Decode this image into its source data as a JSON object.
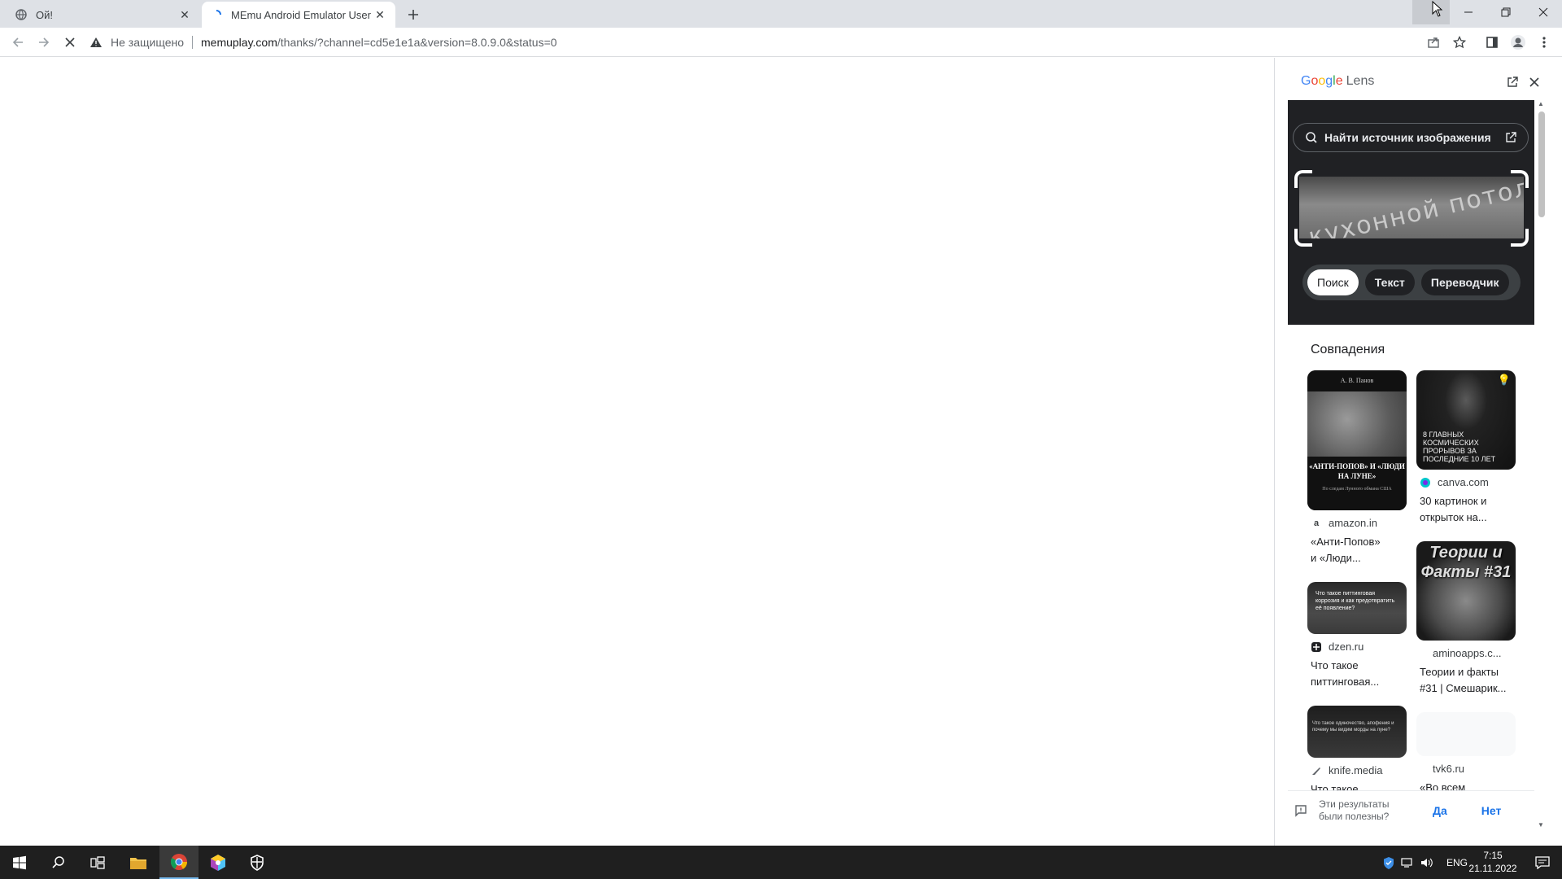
{
  "tabs": [
    {
      "title": "Ой!",
      "active": false
    },
    {
      "title": "MEmu Android Emulator User Gu",
      "active": true
    }
  ],
  "toolbar": {
    "security_label": "Не защищено",
    "url_host": "memuplay.com",
    "url_path": "/thanks/?channel=cd5e1e1a&version=8.0.9.0&status=0"
  },
  "lens": {
    "brand": "Google",
    "brand_suffix": "Lens",
    "find_source_label": "Найти источник изображения",
    "crop_text": "кухонной потолок",
    "modes": [
      "Поиск",
      "Текст",
      "Переводчик"
    ],
    "selected_mode": "Поиск",
    "matches_title": "Совпадения",
    "results": [
      {
        "source": "amazon.in",
        "caption_line1": "«Анти-Попов»",
        "caption_line2": "и «Люди...",
        "thumb_top": "А. В. Панов",
        "thumb_title": "«АНТИ-ПОПОВ» И «ЛЮДИ НА ЛУНЕ»",
        "thumb_sub": "По следам Лунного обмана США"
      },
      {
        "source": "canva.com",
        "caption_line1": "30 картинок и",
        "caption_line2": "открыток на...",
        "thumb_text": "8 ГЛАВНЫХ КОСМИЧЕСКИХ ПРОРЫВОВ ЗА ПОСЛЕДНИЕ 10 ЛЕТ"
      },
      {
        "source": "dzen.ru",
        "caption_line1": "Что такое",
        "caption_line2": "питтинговая...",
        "thumb_text": "Что такое питтинговая коррозия и как предотвратить её появление?"
      },
      {
        "source": "aminoapps.c...",
        "caption_line1": "Теории и факты",
        "caption_line2": "#31 | Смешарик...",
        "thumb_text": "Теории и Факты #31"
      },
      {
        "source": "knife.media",
        "caption_line1": "Что такое",
        "caption_line2": "",
        "thumb_text": "Что такое одиночество, апофения и почему мы видим морды на луне?"
      },
      {
        "source": "tvk6.ru",
        "caption_line1": "«Во всем",
        "caption_line2": ""
      }
    ],
    "feedback_question": "Эти результаты были полезны?",
    "feedback_yes": "Да",
    "feedback_no": "Нет"
  },
  "taskbar": {
    "language": "ENG",
    "time": "7:15",
    "date": "21.11.2022"
  }
}
